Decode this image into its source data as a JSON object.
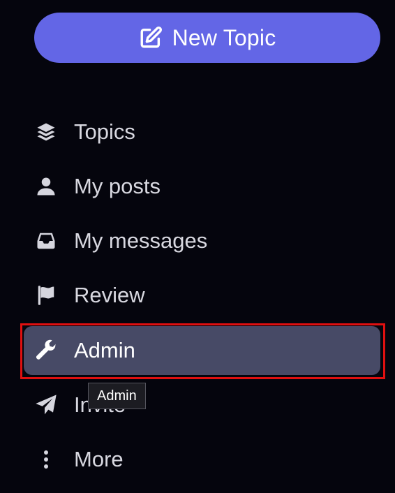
{
  "new_topic": {
    "label": "New Topic",
    "icon": "edit-icon"
  },
  "nav": {
    "items": [
      {
        "id": "topics",
        "label": "Topics",
        "icon": "layers-icon"
      },
      {
        "id": "my-posts",
        "label": "My posts",
        "icon": "user-icon"
      },
      {
        "id": "my-messages",
        "label": "My messages",
        "icon": "inbox-icon"
      },
      {
        "id": "review",
        "label": "Review",
        "icon": "flag-icon"
      },
      {
        "id": "admin",
        "label": "Admin",
        "icon": "wrench-icon",
        "active": true
      },
      {
        "id": "invite",
        "label": "Invite",
        "icon": "paper-plane-icon"
      },
      {
        "id": "more",
        "label": "More",
        "icon": "more-vertical-icon"
      }
    ]
  },
  "tooltip": {
    "text": "Admin"
  },
  "colors": {
    "background": "#05050d",
    "accent": "#6366e6",
    "active_item": "#474a66",
    "highlight": "#e01010"
  }
}
